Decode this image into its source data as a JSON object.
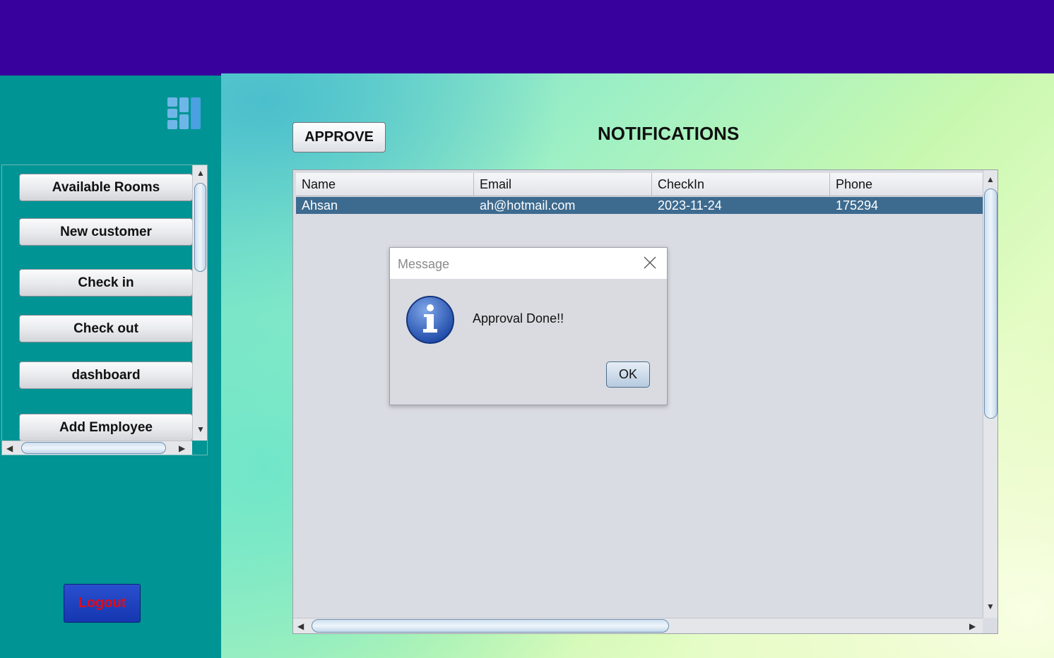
{
  "sidebar": {
    "menu_icon": "grid-menu-icon",
    "nav_items": [
      {
        "label": "Available Rooms"
      },
      {
        "label": "New customer"
      },
      {
        "label": "Check in"
      },
      {
        "label": "Check out"
      },
      {
        "label": "dashboard"
      },
      {
        "label": "Add Employee"
      }
    ],
    "logout_label": "Logout"
  },
  "main": {
    "approve_label": "APPROVE",
    "title": "NOTIFICATIONS",
    "table": {
      "columns": [
        "Name",
        "Email",
        "CheckIn",
        "Phone"
      ],
      "rows": [
        [
          "Ahsan",
          "ah@hotmail.com",
          "2023-11-24",
          "175294"
        ]
      ],
      "selected_row": 0
    }
  },
  "dialog": {
    "title": "Message",
    "icon": "info-icon",
    "message": "Approval Done!!",
    "ok_label": "OK"
  },
  "colors": {
    "topbar": "#38009c",
    "sidebar": "#009494",
    "selected_row": "#3d6a8f",
    "logout_bg": "#1d41c0",
    "logout_text": "#e30b17"
  }
}
